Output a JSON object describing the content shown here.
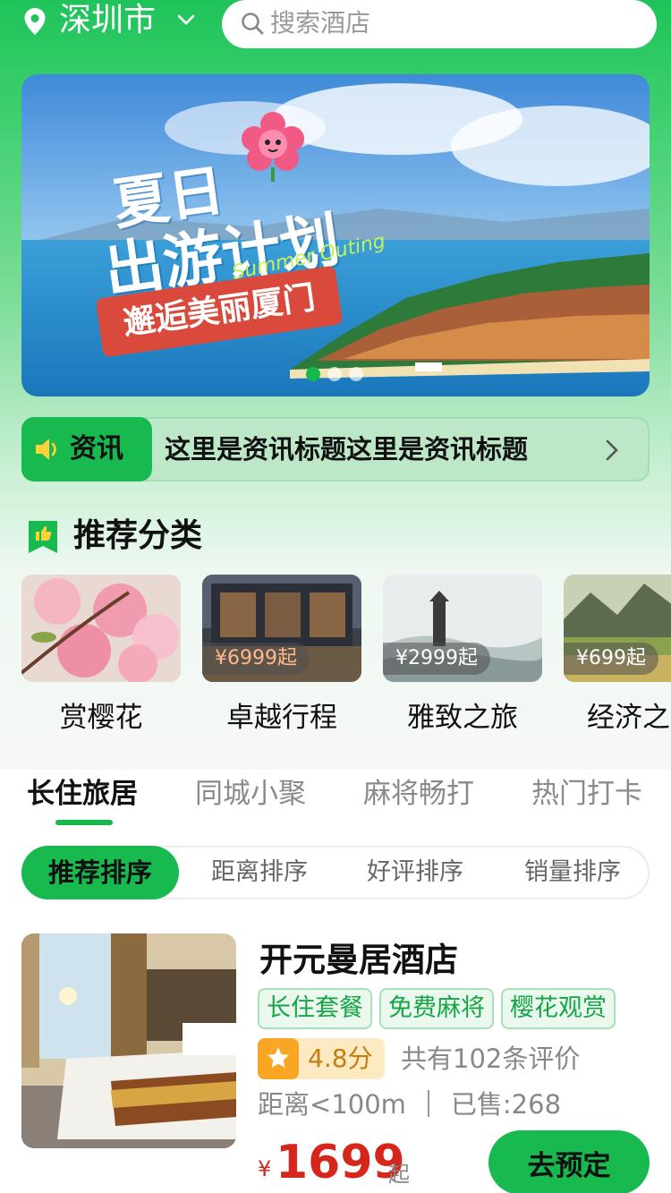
{
  "header": {
    "city": "深圳市",
    "search_placeholder": "搜索酒店"
  },
  "banner": {
    "title_line1": "夏日",
    "title_line2": "出游计划",
    "subtitle_en": "Summer Outing",
    "tag": "邂逅美丽厦门",
    "dots": 3,
    "active_dot": 0
  },
  "news": {
    "label": "资讯",
    "title": "这里是资讯标题这里是资讯标题"
  },
  "section": {
    "title": "推荐分类"
  },
  "categories": [
    {
      "name": "赏樱花",
      "price": ""
    },
    {
      "name": "卓越行程",
      "price": "¥6999起"
    },
    {
      "name": "雅致之旅",
      "price": "¥2999起"
    },
    {
      "name": "经济之",
      "price": "¥699起"
    }
  ],
  "tabs": [
    "长住旅居",
    "同城小聚",
    "麻将畅打",
    "热门打卡"
  ],
  "active_tab": 0,
  "sorts": [
    "推荐排序",
    "距离排序",
    "好评排序",
    "销量排序"
  ],
  "active_sort": 0,
  "hotel": {
    "name": "开元曼居酒店",
    "tags": [
      "长住套餐",
      "免费麻将",
      "樱花观赏"
    ],
    "rating": "4.8分",
    "reviews": "共有102条评价",
    "distance": "距离<100m",
    "sold": "已售:268",
    "currency": "¥",
    "price": "1699",
    "price_suffix": "起",
    "book_label": "去预定"
  },
  "colors": {
    "brand_green": "#18b94e",
    "price_red": "#d6261c",
    "rating_orange": "#f8a623"
  }
}
